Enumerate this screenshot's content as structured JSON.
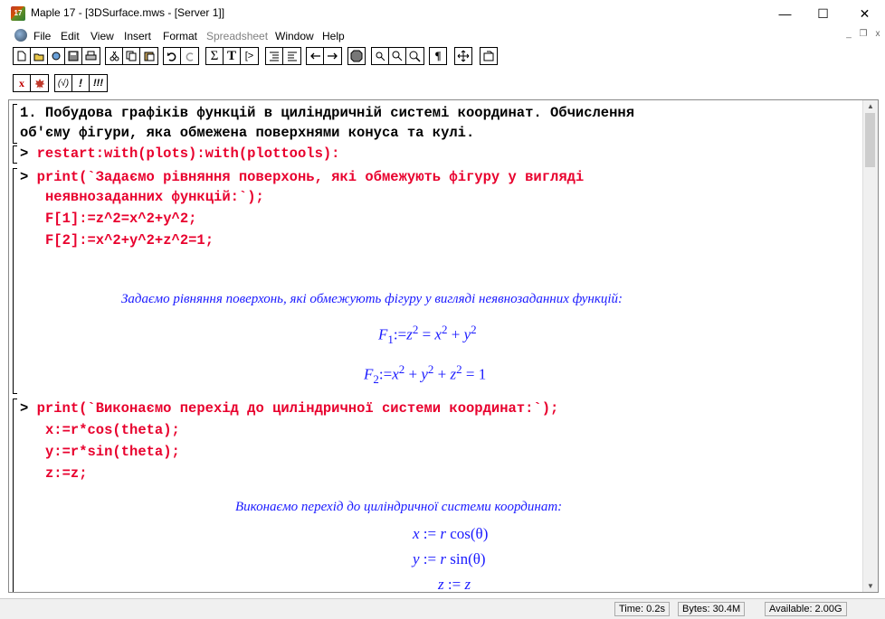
{
  "window": {
    "app_icon_text": "17",
    "title": "Maple 17 - [3DSurface.mws - [Server 1]]",
    "minimize": "—",
    "maximize": "☐",
    "close": "✕"
  },
  "menu": {
    "items": [
      "File",
      "Edit",
      "View",
      "Insert",
      "Format",
      "Spreadsheet",
      "Window",
      "Help"
    ],
    "disabled_item": "Spreadsheet",
    "mdi_minimize": "_",
    "mdi_restore": "❐",
    "mdi_close": "x"
  },
  "toolbar": {
    "sum": "Σ",
    "text": "T",
    "exec": "[>",
    "paragraph": "¶",
    "m1": "x",
    "m3": "(√)",
    "m4": "!",
    "m5": "!!!"
  },
  "worksheet": {
    "heading_line1": "1. Побудова графіків функцій в циліндричній системі координат. Обчислення",
    "heading_line2": "об'єму фігури, яка обмежена поверхнями конуса та кулі.",
    "prompt": ">",
    "g1": {
      "line1": "restart:with(plots):with(plottools):"
    },
    "g2": {
      "line1": "print(`Задаємо рівняння поверхонь, які обмежують фігуру у вигляді",
      "line2": "неявнозаданних функцій:`);",
      "line3": "F[1]:=z^2=x^2+y^2;",
      "line4": "F[2]:=x^2+y^2+z^2=1;",
      "output_text": "Задаємо рівняння поверхонь, які обмежують фігуру у вигляді неявнозаданних функцій:",
      "eq1": {
        "lhs": "F",
        "sub": "1",
        "assign": ":=",
        "a": "z",
        "eq": "=",
        "b": "x",
        "plus": "+",
        "c": "y",
        "exp": "2"
      },
      "eq2": {
        "lhs": "F",
        "sub": "2",
        "assign": ":=",
        "a": "x",
        "plus": "+",
        "b": "y",
        "c": "z",
        "eq": "=",
        "rhs": "1",
        "exp": "2"
      }
    },
    "g3": {
      "line1": "print(`Виконаємо перехід до циліндричної системи координат:`);",
      "line2": "x:=r*cos(theta);",
      "line3": "y:=r*sin(theta);",
      "line4": "z:=z;",
      "output_text": "Виконаємо перехід до циліндричної системи координат:",
      "o1": {
        "lhs": "x",
        "assign": ":=",
        "r": "r",
        "fn": "cos(θ)"
      },
      "o2": {
        "lhs": "y",
        "assign": ":=",
        "r": "r",
        "fn": "sin(θ)"
      },
      "o3": {
        "lhs": "z",
        "assign": ":=",
        "rhs": "z"
      }
    }
  },
  "status": {
    "time": "Time:  0.2s",
    "bytes": "Bytes: 30.4M",
    "available": "Available: 2.00G"
  }
}
